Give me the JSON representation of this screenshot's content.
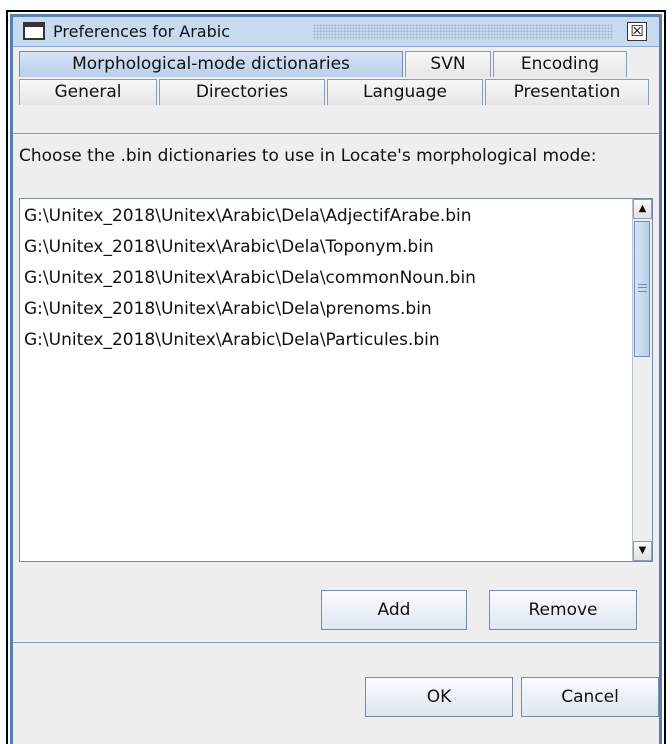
{
  "window": {
    "title": "Preferences for Arabic",
    "close_glyph": "☒",
    "icon": "window-icon"
  },
  "tabs": {
    "row1": [
      {
        "label": "Morphological-mode dictionaries",
        "selected": true
      },
      {
        "label": "SVN",
        "selected": false
      },
      {
        "label": "Encoding",
        "selected": false
      }
    ],
    "row2": [
      {
        "label": "General",
        "selected": false
      },
      {
        "label": "Directories",
        "selected": false
      },
      {
        "label": "Language",
        "selected": false
      },
      {
        "label": "Presentation",
        "selected": false
      }
    ]
  },
  "panel": {
    "instruction": "Choose the .bin dictionaries to use in Locate's morphological mode:",
    "dictionaries": [
      "G:\\Unitex_2018\\Unitex\\Arabic\\Dela\\AdjectifArabe.bin",
      "G:\\Unitex_2018\\Unitex\\Arabic\\Dela\\Toponym.bin",
      "G:\\Unitex_2018\\Unitex\\Arabic\\Dela\\commonNoun.bin",
      "G:\\Unitex_2018\\Unitex\\Arabic\\Dela\\prenoms.bin",
      "G:\\Unitex_2018\\Unitex\\Arabic\\Dela\\Particules.bin"
    ],
    "add_label": "Add",
    "remove_label": "Remove"
  },
  "footer": {
    "ok_label": "OK",
    "cancel_label": "Cancel"
  },
  "scrollbar": {
    "up_glyph": "▲",
    "down_glyph": "▼"
  },
  "colors": {
    "title_bar": "#c8daf0",
    "selected_tab": "#b9cfe9",
    "border_accent": "#5c7fb2"
  }
}
